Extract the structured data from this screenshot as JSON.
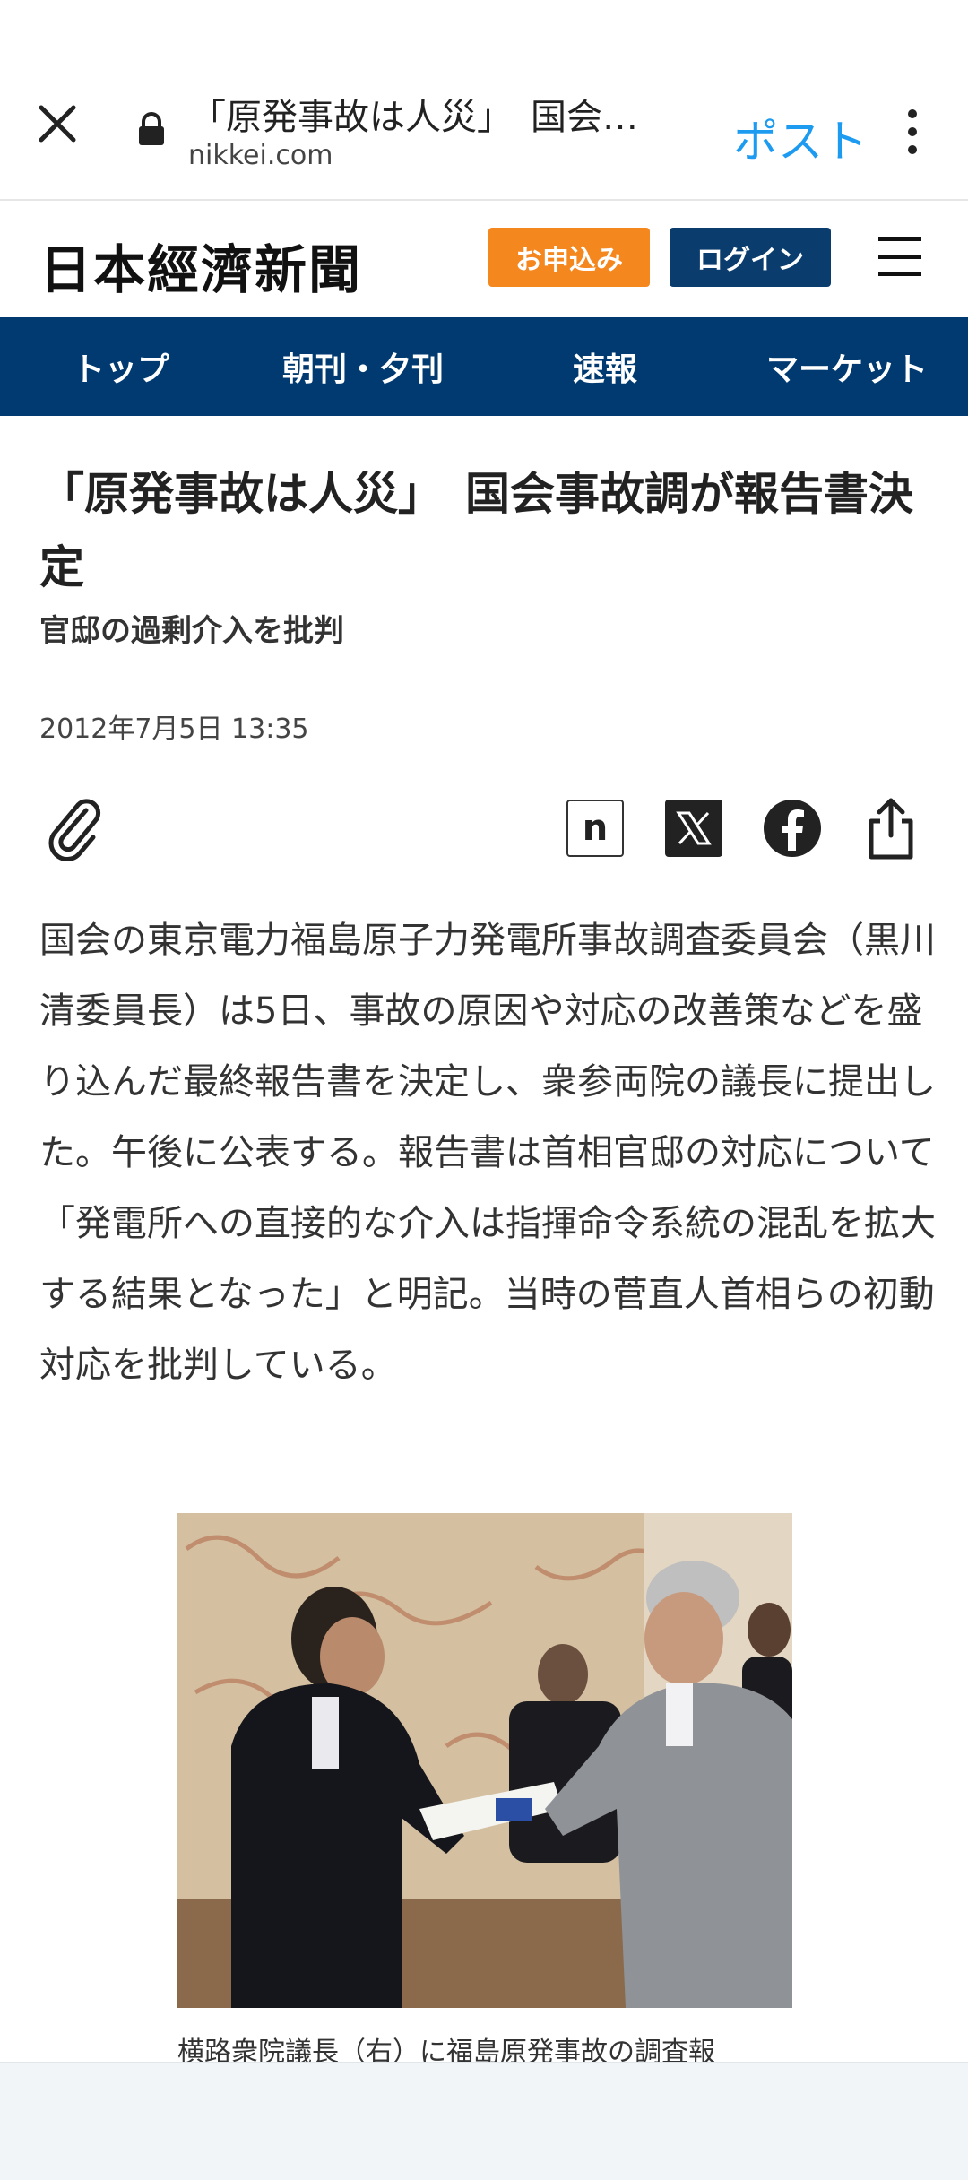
{
  "browser": {
    "title": "「原発事故は人災」　国会…",
    "domain": "nikkei.com",
    "post_label": "ポスト"
  },
  "header": {
    "logo": "日本經濟新聞",
    "subscribe_label": "お申込み",
    "login_label": "ログイン"
  },
  "nav": {
    "items": [
      {
        "label": "トップ"
      },
      {
        "label": "朝刊・夕刊"
      },
      {
        "label": "速報"
      },
      {
        "label": "マーケット"
      }
    ]
  },
  "article": {
    "headline": "「原発事故は人災」　国会事故調が報告書決定",
    "subheadline": "官邸の過剰介入を批判",
    "date": "2012年7月5日 13:35",
    "body": "国会の東京電力福島原子力発電所事故調査委員会（黒川清委員長）は5日、事故の原因や対応の改善策などを盛り込んだ最終報告書を決定し、衆参両院の議長に提出した。午後に公表する。報告書は首相官邸の対応について「発電所への直接的な介入は指揮命令系統の混乱を拡大する結果となった」と明記。当時の菅直人首相らの初動対応を批判している。",
    "caption": "横路衆院議長（右）に福島原発事故の調査報"
  },
  "share": {
    "note_letter": "n"
  },
  "colors": {
    "nav_bg": "#003a70",
    "subscribe_bg": "#f5871f",
    "login_bg": "#0b3c6e",
    "post_blue": "#1d9bf0"
  }
}
